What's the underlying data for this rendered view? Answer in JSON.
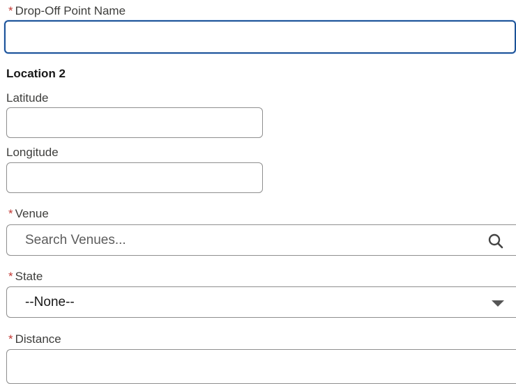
{
  "form": {
    "drop_off": {
      "required_mark": "*",
      "label": "Drop-Off Point Name",
      "value": ""
    },
    "section_title": "Location 2",
    "latitude": {
      "label": "Latitude",
      "value": ""
    },
    "longitude": {
      "label": "Longitude",
      "value": ""
    },
    "venue": {
      "required_mark": "*",
      "label": "Venue",
      "placeholder": "Search Venues...",
      "icon": "search-icon"
    },
    "state": {
      "required_mark": "*",
      "label": "State",
      "selected": "--None--",
      "icon": "chevron-down-icon"
    },
    "distance": {
      "required_mark": "*",
      "label": "Distance",
      "value": ""
    }
  },
  "colors": {
    "required": "#c23934",
    "focus_border": "#1b5297",
    "border": "#8e8e8e"
  }
}
